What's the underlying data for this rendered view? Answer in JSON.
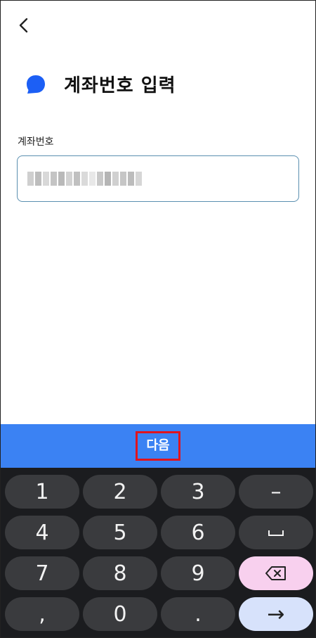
{
  "header": {
    "back_icon": "chevron-left-icon"
  },
  "title": {
    "logo_icon": "speech-bubble-logo-icon",
    "text": "계좌번호 입력"
  },
  "form": {
    "label": "계좌번호",
    "value_masked": true
  },
  "next_button": {
    "label": "다음"
  },
  "keyboard": {
    "rows": [
      [
        "1",
        "2",
        "3",
        "–"
      ],
      [
        "4",
        "5",
        "6",
        "␣"
      ],
      [
        "7",
        "8",
        "9",
        "backspace"
      ],
      [
        ",",
        "0",
        ".",
        "→"
      ]
    ],
    "labels": {
      "k1": "1",
      "k2": "2",
      "k3": "3",
      "dash": "–",
      "k4": "4",
      "k5": "5",
      "k6": "6",
      "space": "␣",
      "k7": "7",
      "k8": "8",
      "k9": "9",
      "comma": ",",
      "k0": "0",
      "dot": ".",
      "go": "→"
    }
  },
  "colors": {
    "accent": "#3b82f3",
    "highlight": "#e0141e",
    "keyboard_bg": "#1b1c1f"
  }
}
